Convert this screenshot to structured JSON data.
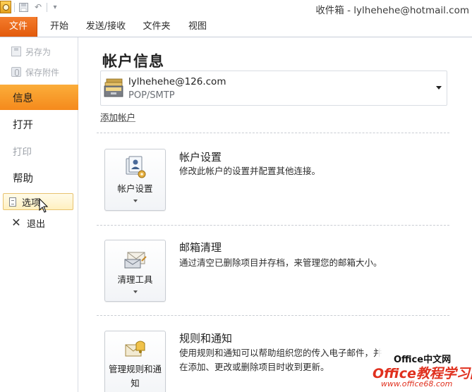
{
  "window": {
    "title": "收件箱 - lylhehehe@hotmail.com",
    "qat": [
      "app-icon",
      "save-icon",
      "undo-icon",
      "customize-icon"
    ]
  },
  "ribbon": {
    "tabs": [
      {
        "label": "文件",
        "active": true
      },
      {
        "label": "开始"
      },
      {
        "label": "发送/接收"
      },
      {
        "label": "文件夹"
      },
      {
        "label": "视图"
      }
    ]
  },
  "nav": {
    "save_as": "另存为",
    "save_attachment": "保存附件",
    "info": "信息",
    "open": "打开",
    "print": "打印",
    "help": "帮助",
    "options": "选项",
    "exit": "退出"
  },
  "main": {
    "title": "帐户信息",
    "account": {
      "email": "lylhehehe@126.com",
      "type": "POP/SMTP"
    },
    "add_account": "添加帐户",
    "sections": [
      {
        "button_label": "帐户设置",
        "title": "帐户设置",
        "description": "修改此帐户的设置并配置其他连接。"
      },
      {
        "button_label": "清理工具",
        "title": "邮箱清理",
        "description": "通过清空已删除项目并存档，来管理您的邮箱大小。"
      },
      {
        "button_label": "管理规则和通知",
        "title": "规则和通知",
        "description": "使用规则和通知可以帮助组织您的传入电子邮件，并在添加、更改或删除项目时收到更新。"
      }
    ]
  },
  "watermark": {
    "line1": "Office中文网",
    "line2": "Office教程学习网",
    "line3": "www.office68.com"
  },
  "colors": {
    "file_tab": "#e8681a",
    "active_nav": "#f89c28",
    "option_hover": "#fff3c8"
  }
}
